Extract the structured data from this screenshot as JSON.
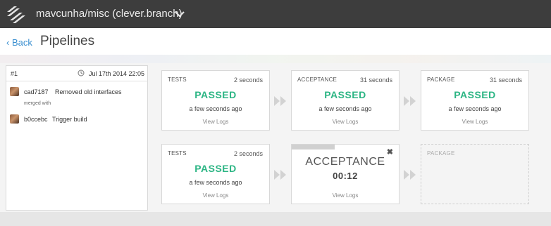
{
  "topbar": {
    "repo_title": "mavcunha/misc (clever.branch)",
    "logo_icon": "stacked-bars-logo",
    "dropdown_icon": "chevron-down-icon"
  },
  "header": {
    "back_label": "‹ Back",
    "title": "Pipelines"
  },
  "build": {
    "number": "#1",
    "date": "Jul 17th 2014 22:05",
    "commits": [
      {
        "sha": "cad7187",
        "message": "Removed old interfaces"
      },
      {
        "sha": "b0ccebc",
        "message": "Trigger build"
      }
    ],
    "merged_label": "merged with"
  },
  "pipelines": [
    {
      "stages": [
        {
          "name": "TESTS",
          "duration": "2 seconds",
          "status": "PASSED",
          "ago": "a few seconds ago",
          "logs": "View Logs"
        },
        {
          "name": "ACCEPTANCE",
          "duration": "31 seconds",
          "status": "PASSED",
          "ago": "a few seconds ago",
          "logs": "View Logs"
        },
        {
          "name": "PACKAGE",
          "duration": "31 seconds",
          "status": "PASSED",
          "ago": "a few seconds ago",
          "logs": "View Logs"
        }
      ]
    },
    {
      "stages": [
        {
          "name": "TESTS",
          "duration": "2 seconds",
          "status": "PASSED",
          "ago": "a few seconds ago",
          "logs": "View Logs"
        },
        {
          "name": "ACCEPTANCE",
          "timer": "00:12",
          "logs": "View Logs",
          "progress": 0.4
        },
        {
          "name": "PACKAGE"
        }
      ]
    }
  ],
  "colors": {
    "topbar": "#3d3d3d",
    "passed": "#2cb584",
    "link": "#3a8fd0"
  }
}
